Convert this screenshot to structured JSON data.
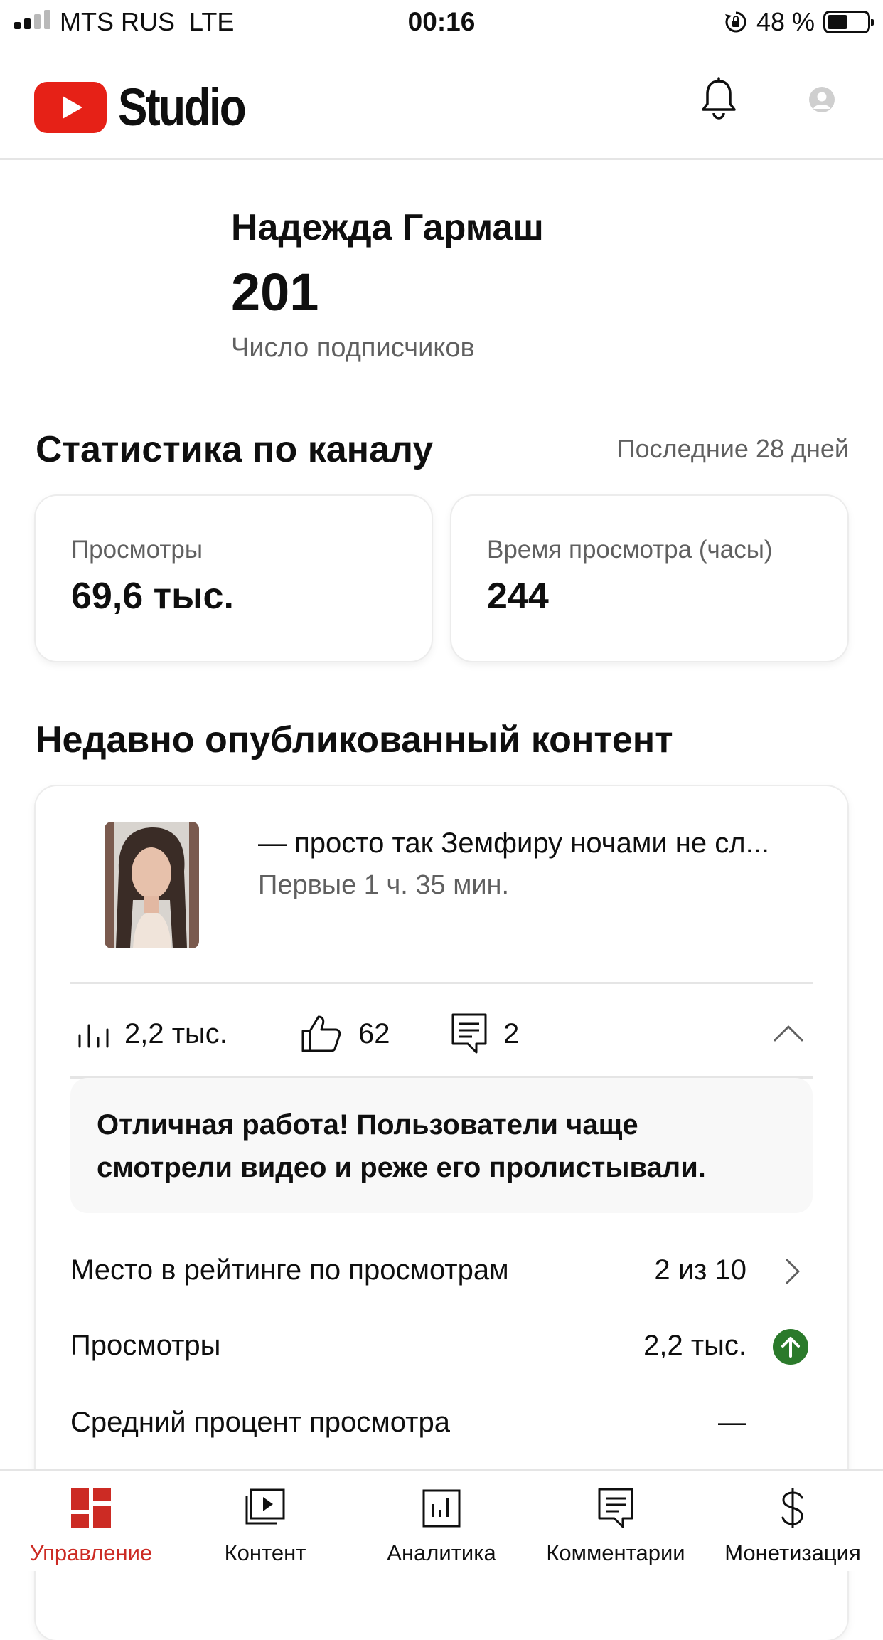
{
  "status_bar": {
    "carrier": "MTS RUS",
    "network": "LTE",
    "time": "00:16",
    "battery": "48 %"
  },
  "header": {
    "app_name": "Studio"
  },
  "channel": {
    "name": "Надежда Гармаш",
    "subscribers": "201",
    "subscribers_label": "Число подписчиков"
  },
  "stats": {
    "title": "Статистика по каналу",
    "period": "Последние 28 дней",
    "cards": [
      {
        "label": "Просмотры",
        "value": "69,6 тыс."
      },
      {
        "label": "Время просмотра (часы)",
        "value": "244"
      }
    ]
  },
  "recent": {
    "title": "Недавно опубликованный контент",
    "video": {
      "title": "— просто так Земфиру ночами не сл...",
      "subtitle": "Первые 1 ч. 35 мин.",
      "views": "2,2 тыс.",
      "likes": "62",
      "comments": "2"
    },
    "notice": "Отличная работа! Пользователи чаще смотрели видео и реже его пролистывали.",
    "rows": [
      {
        "label": "Место в рейтинге по просмотрам",
        "value": "2 из 10"
      },
      {
        "label": "Просмотры",
        "value": "2,2 тыс."
      },
      {
        "label": "Средний процент просмотра",
        "value": "—"
      }
    ]
  },
  "nav": [
    {
      "label": "Управление",
      "active": true
    },
    {
      "label": "Контент"
    },
    {
      "label": "Аналитика"
    },
    {
      "label": "Комментарии"
    },
    {
      "label": "Монетизация"
    }
  ],
  "colors": {
    "brand_red": "#e62117",
    "active_nav": "#cc2b24",
    "up_green": "#2b7a2b"
  }
}
